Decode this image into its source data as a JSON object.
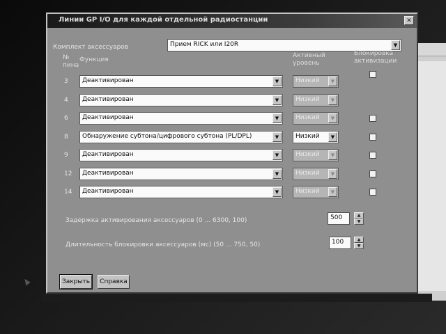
{
  "window": {
    "title": "Линии GP I/O для каждой отдельной радиостанции",
    "close": "✕"
  },
  "accessory_kit": {
    "label": "Комплект аксессуаров",
    "value": "Прием RICK или I20R"
  },
  "headers": {
    "pin_line1": "№",
    "pin_line2": "пина",
    "function": "Функция",
    "active_line1": "Активный",
    "active_line2": "уровень",
    "lock_line1": "Блокировка",
    "lock_line2": "активизации"
  },
  "rows": [
    {
      "pin": "3",
      "function": "Деактивирован",
      "level": "Низкий",
      "level_enabled": false,
      "has_lock": true
    },
    {
      "pin": "4",
      "function": "Деактивирован",
      "level": "Низкий",
      "level_enabled": false,
      "has_lock": false
    },
    {
      "pin": "6",
      "function": "Деактивирован",
      "level": "Низкий",
      "level_enabled": false,
      "has_lock": true
    },
    {
      "pin": "8",
      "function": "Обнаружение субтона/цифрового субтона (PL/DPL)",
      "level": "Низкий",
      "level_enabled": true,
      "has_lock": true
    },
    {
      "pin": "9",
      "function": "Деактивирован",
      "level": "Низкий",
      "level_enabled": false,
      "has_lock": true
    },
    {
      "pin": "12",
      "function": "Деактивирован",
      "level": "Низкий",
      "level_enabled": false,
      "has_lock": true
    },
    {
      "pin": "14",
      "function": "Деактивирован",
      "level": "Низкий",
      "level_enabled": false,
      "has_lock": true
    }
  ],
  "delay": {
    "label": "Задержка активирования аксессуаров (0 ... 6300, 100)",
    "value": "500"
  },
  "lock_duration": {
    "label": "Длительность блокировки аксессуаров (мс) (50 ... 750, 50)",
    "value": "100"
  },
  "buttons": {
    "close": "Закрыть",
    "help": "Справка"
  },
  "icons": {
    "dropdown": "chevron-down-icon",
    "spin_up": "spin-up-icon",
    "spin_down": "spin-down-icon"
  }
}
